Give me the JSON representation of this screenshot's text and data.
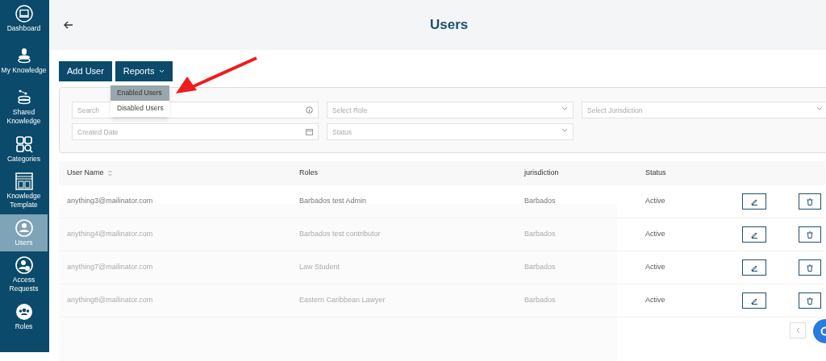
{
  "sidebar": {
    "items": [
      {
        "label": "Dashboard",
        "selected": false
      },
      {
        "label": "My Knowledge",
        "selected": false
      },
      {
        "label": "Shared Knowledge",
        "selected": false
      },
      {
        "label": "Categories",
        "selected": false
      },
      {
        "label": "Knowledge Template",
        "selected": false
      },
      {
        "label": "Users",
        "selected": true
      },
      {
        "label": "Access Requests",
        "selected": false
      },
      {
        "label": "Roles",
        "selected": false
      }
    ]
  },
  "header": {
    "title": "Users"
  },
  "toolbar": {
    "add_button": "Add User",
    "reports_button": "Reports"
  },
  "reports_menu": [
    {
      "label": "Enabled Users",
      "selected": true
    },
    {
      "label": "Disabled Users",
      "selected": false
    }
  ],
  "filters": [
    {
      "kind": "search",
      "placeholder": "Search"
    },
    {
      "kind": "select",
      "placeholder": "Select Role"
    },
    {
      "kind": "select",
      "placeholder": "Select Jurisdiction"
    },
    {
      "kind": "date",
      "placeholder": "Created Date"
    },
    {
      "kind": "select",
      "placeholder": "Status"
    }
  ],
  "table": {
    "columns": [
      "User Name",
      "Roles",
      "jurisdiction",
      "Status"
    ],
    "rows": [
      {
        "user_name": "anything3@mailinator.com",
        "role": "Barbados test Admin",
        "jurisdiction": "Barbados",
        "status": "Active"
      },
      {
        "user_name": "anything4@mailinator.com",
        "role": "Barbados test contributor",
        "jurisdiction": "Barbados",
        "status": "Active"
      },
      {
        "user_name": "anything7@mailinator.com",
        "role": "Law Student",
        "jurisdiction": "Barbados",
        "status": "Active"
      },
      {
        "user_name": "anything8@mailinator.com",
        "role": "Eastern Caribbean Lawyer",
        "jurisdiction": "Barbados",
        "status": "Active"
      }
    ]
  }
}
